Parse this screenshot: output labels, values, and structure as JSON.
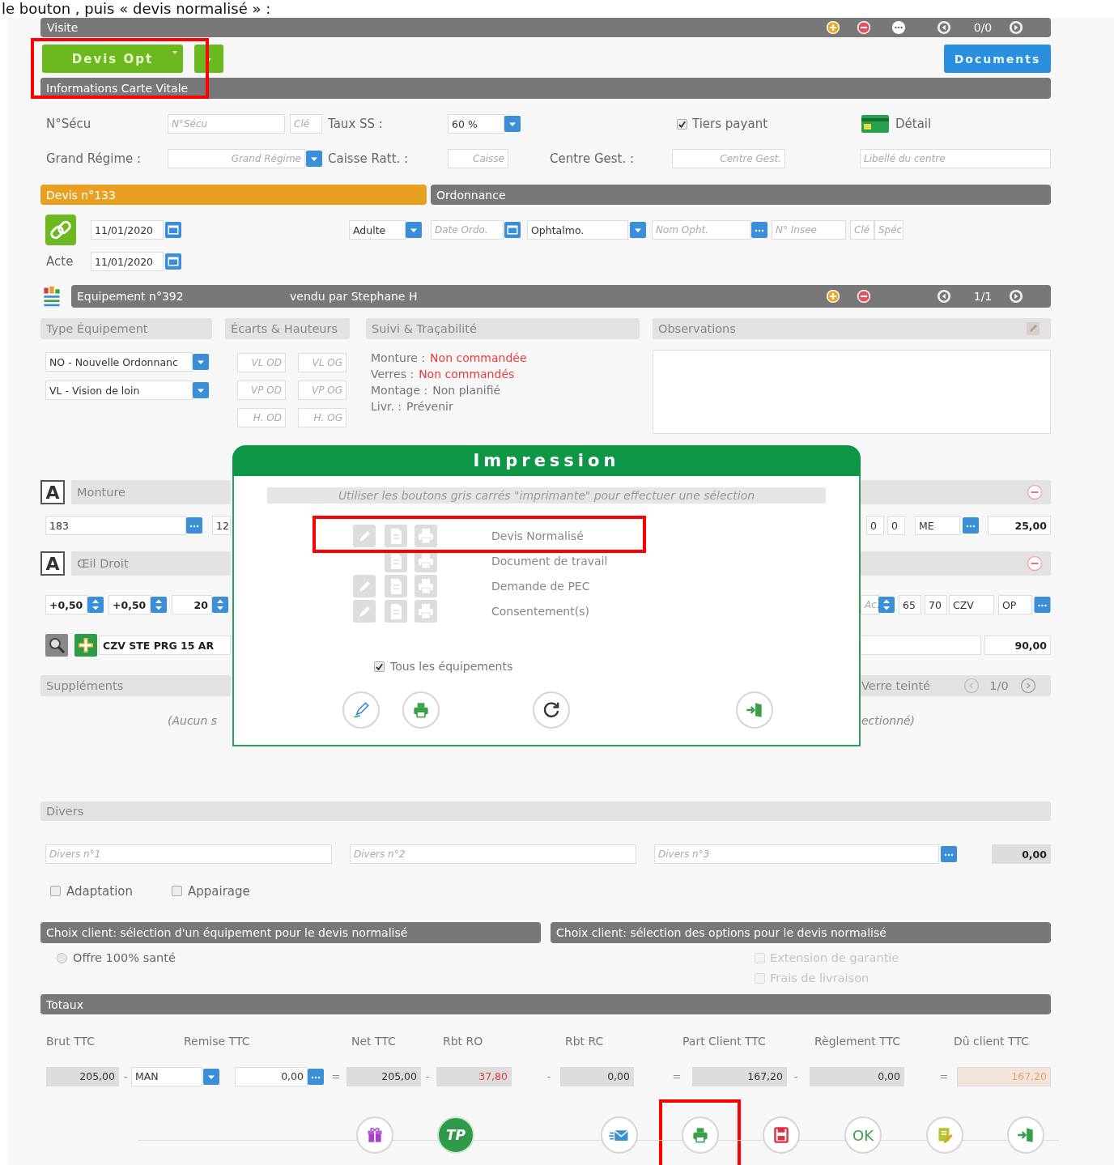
{
  "caption": "le bouton , puis « devis normalisé » :",
  "visite": {
    "title": "Visite",
    "counter": "0/0"
  },
  "devis_button": {
    "label": "Devis Opt",
    "highlighted": true
  },
  "documents_button": "Documents",
  "carte_vitale": {
    "title": "Informations Carte Vitale",
    "secu_label": "N°Sécu",
    "secu_placeholder": "N°Sécu",
    "cle_placeholder": "Clé",
    "taux_label": "Taux SS :",
    "taux_value": "60 %",
    "tiers_payant": {
      "label": "Tiers payant",
      "checked": true
    },
    "detail": "Détail",
    "regime_label": "Grand Régime :",
    "regime_placeholder": "Grand Régime",
    "caisse_label": "Caisse Ratt. :",
    "caisse_placeholder": "Caisse",
    "centre_label": "Centre Gest. :",
    "centre_placeholder": "Centre Gest.",
    "libelle_placeholder": "Libellé du centre"
  },
  "devis": {
    "title": "Devis n°133",
    "date": "11/01/2020",
    "acte_label": "Acte",
    "acte_date": "11/01/2020"
  },
  "ordonnance": {
    "title": "Ordonnance",
    "patient_type": "Adulte",
    "date_placeholder": "Date Ordo.",
    "prescriber_type": "Ophtalmo.",
    "name_placeholder": "Nom Opht.",
    "insee_placeholder": "N° Insee",
    "key_placeholder": "Clé",
    "spec_placeholder": "Spéc"
  },
  "equipement": {
    "title": "Equipement n°392",
    "seller": "vendu par Stephane H",
    "counter": "1/1"
  },
  "type_equipement": {
    "title": "Type Équipement",
    "selects": [
      "NO - Nouvelle Ordonnanc",
      "VL - Vision de loin"
    ]
  },
  "ecarts": {
    "title": "Écarts & Hauteurs",
    "placeholders": [
      "VL OD",
      "VL OG",
      "VP OD",
      "VP OG",
      "H. OD",
      "H. OG"
    ]
  },
  "suivi": {
    "title": "Suivi & Traçabilité",
    "lines": [
      {
        "label": "Monture :",
        "value": "Non commandée",
        "alert": true
      },
      {
        "label": "Verres :",
        "value": "Non commandés",
        "alert": true
      },
      {
        "label": "Montage :",
        "value": "Non planifié",
        "alert": false
      },
      {
        "label": "Livr. :",
        "value": "Prévenir",
        "alert": false
      }
    ]
  },
  "observations": {
    "title": "Observations"
  },
  "monture": {
    "badge": "A",
    "title": "Monture",
    "fields": [
      "183",
      "12"
    ],
    "right_fields": [
      "0",
      "0",
      "ME"
    ],
    "price": "25,00"
  },
  "oeil_droit": {
    "badge": "A",
    "title": "Œil Droit",
    "corrections": [
      "+0,50",
      "+0,50",
      "20"
    ],
    "right_spinner": "Ac.",
    "right_fields": [
      "65",
      "70",
      "CZV",
      "OP"
    ],
    "lens": "CZV STE PRG 15 AR",
    "price": "90,00"
  },
  "supplements": {
    "title": "Suppléments",
    "empty_text": "(Aucun s",
    "right_title": "Verre teinté",
    "right_counter": "1/0",
    "right_empty_text": "ectionné)"
  },
  "divers": {
    "title": "Divers",
    "placeholders": [
      "Divers n°1",
      "Divers n°2",
      "Divers n°3"
    ],
    "total": "0,00",
    "checkboxes": [
      {
        "label": "Adaptation",
        "checked": false
      },
      {
        "label": "Appairage",
        "checked": false
      }
    ]
  },
  "choix": {
    "equipment_title": "Choix client: sélection d'un équipement pour le devis normalisé",
    "offers": [
      {
        "label": "Offre 100% santé",
        "selected": false
      }
    ],
    "options_title": "Choix client: sélection des options pour le devis normalisé",
    "options": [
      {
        "label": "Extension de garantie",
        "checked": false,
        "disabled": true
      },
      {
        "label": "Frais de livraison",
        "checked": false,
        "disabled": true
      }
    ]
  },
  "totaux": {
    "title": "Totaux",
    "labels": [
      "Brut TTC",
      "Remise TTC",
      "Net TTC",
      "Rbt RO",
      "Rbt RC",
      "Part Client TTC",
      "Règlement TTC",
      "Dû client TTC"
    ],
    "cells": [
      {
        "kind": "amount",
        "value": "205,00"
      },
      {
        "kind": "operator",
        "value": "-"
      },
      {
        "kind": "select",
        "value": "MAN"
      },
      {
        "kind": "input",
        "value": "0,00"
      },
      {
        "kind": "operator",
        "value": "="
      },
      {
        "kind": "amount",
        "value": "205,00"
      },
      {
        "kind": "operator",
        "value": "-"
      },
      {
        "kind": "amount",
        "value": "37,80",
        "color": "#e0413a"
      },
      {
        "kind": "operator",
        "value": "-"
      },
      {
        "kind": "amount",
        "value": "0,00"
      },
      {
        "kind": "operator",
        "value": "="
      },
      {
        "kind": "amount",
        "value": "167,20"
      },
      {
        "kind": "operator",
        "value": "-"
      },
      {
        "kind": "amount",
        "value": "0,00"
      },
      {
        "kind": "operator",
        "value": "="
      },
      {
        "kind": "amount",
        "value": "167,20",
        "color": "#f0a060"
      }
    ]
  },
  "toolbar": [
    {
      "kind": "gift",
      "highlighted": false
    },
    {
      "kind": "tp",
      "label": "TP",
      "highlighted": false
    },
    {
      "kind": "mail",
      "highlighted": false
    },
    {
      "kind": "print",
      "highlighted": true
    },
    {
      "kind": "save",
      "highlighted": false
    },
    {
      "kind": "ok",
      "label": "OK",
      "highlighted": false
    },
    {
      "kind": "sign",
      "highlighted": false
    },
    {
      "kind": "exit",
      "highlighted": false
    }
  ],
  "print_dialog": {
    "title": "Impression",
    "hint": "Utiliser les boutons gris carrés \"imprimante\" pour effectuer une sélection",
    "documents": [
      {
        "label": "Devis Normalisé",
        "signable": true,
        "highlighted": true
      },
      {
        "label": "Document de travail",
        "signable": false,
        "highlighted": false
      },
      {
        "label": "Demande de PEC",
        "signable": true,
        "highlighted": false
      },
      {
        "label": "Consentement(s)",
        "signable": true,
        "highlighted": false
      }
    ],
    "all_equipments": {
      "label": "Tous les équipements",
      "checked": true
    },
    "actions": [
      {
        "kind": "sign"
      },
      {
        "kind": "print"
      },
      {
        "kind": "refresh"
      },
      {
        "kind": "exit"
      }
    ]
  }
}
